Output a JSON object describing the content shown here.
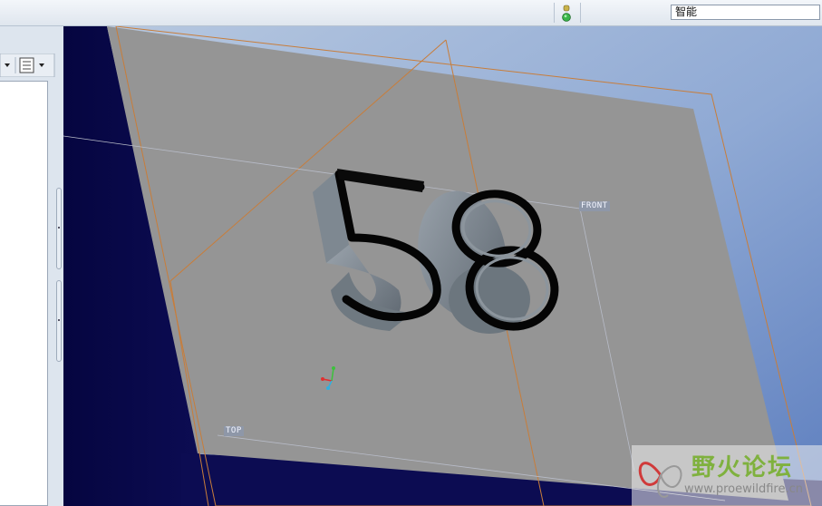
{
  "toolbar": {
    "filter_value": "智能",
    "icons": [
      "traffic-light-icon"
    ]
  },
  "left_panel": {
    "tabs": [
      "dropdown-arrow-icon",
      "tree-settings-icon"
    ]
  },
  "viewport": {
    "model_text": "58",
    "datum_planes": [
      "FRONT",
      "TOP"
    ],
    "colors": {
      "background": "#0a0a4a",
      "background_gradient_end": "#6f8fc8",
      "plate": "#959595",
      "extrude": "#7d8790",
      "datum_line": "#c87d3a"
    }
  },
  "watermark": {
    "title": "野火论坛",
    "url": "www.proewildfire.cn"
  }
}
